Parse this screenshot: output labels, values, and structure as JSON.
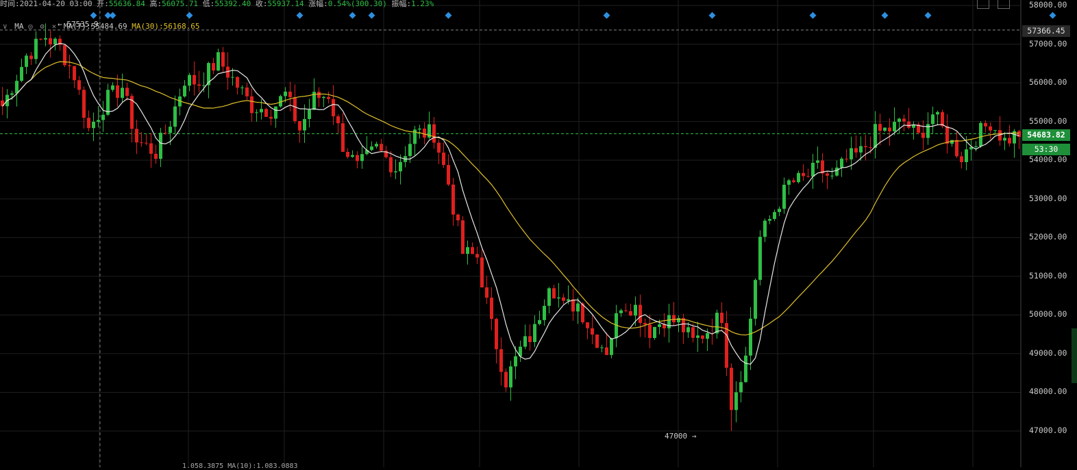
{
  "header": {
    "time_label": "时间:",
    "time": "2021-04-20 03:00",
    "open_label": "开:",
    "open": "55636.84",
    "high_label": "高:",
    "high": "56075.71",
    "low_label": "低:",
    "low": "55392.40",
    "close_label": "收:",
    "close": "55937.14",
    "change_label": "涨幅:",
    "change": "0.54%(300.30)",
    "amp_label": "振幅:",
    "amp": "1.23%"
  },
  "ma_bar": {
    "indicator": "MA",
    "ma7": "MA(7):55484.69",
    "ma30": "MA(30):56168.65"
  },
  "price_tags": {
    "high_line": "57366.45",
    "current": "54683.82",
    "timer": "53:30"
  },
  "annotations": {
    "max_marker": "← 57535.9",
    "min_marker": "47000 →"
  },
  "bottom_panel": {
    "text": "1.058.3875  MA(10):1.083.0883"
  },
  "colors": {
    "up": "#2fbf45",
    "down": "#e0201e",
    "ma7": "#e8e8e8",
    "ma30": "#e0c12c",
    "grid": "#1f1f1f",
    "signal_marker": "#2d8fe0"
  },
  "chart_data": {
    "type": "candlestick",
    "title": "",
    "y_axis_ticks": [
      58000,
      57000,
      56000,
      55000,
      54000,
      53000,
      52000,
      51000,
      50000,
      49000,
      48000,
      47000
    ],
    "y_axis_labels": [
      "58000.00",
      "57000.00",
      "56000.00",
      "55000.00",
      "54000.00",
      "53000.00",
      "52000.00",
      "51000.00",
      "50000.00",
      "49000.00",
      "48000.00",
      "47000.00"
    ],
    "ylim": [
      46800,
      58000
    ],
    "grid": true,
    "reference_lines": {
      "high": 57366.45,
      "current": 54683.82
    },
    "signal_marker_candle_index": [
      19,
      22,
      23,
      39,
      62,
      73,
      77,
      93,
      126,
      148,
      169,
      184,
      193,
      219
    ],
    "price_anchors": [
      [
        0,
        55400
      ],
      [
        5,
        56700
      ],
      [
        9,
        57200
      ],
      [
        12,
        56900
      ],
      [
        15,
        56200
      ],
      [
        18,
        54800
      ],
      [
        22,
        55600
      ],
      [
        25,
        55900
      ],
      [
        28,
        54500
      ],
      [
        32,
        54200
      ],
      [
        35,
        55000
      ],
      [
        38,
        56100
      ],
      [
        41,
        56000
      ],
      [
        45,
        56600
      ],
      [
        48,
        56100
      ],
      [
        52,
        55400
      ],
      [
        56,
        55300
      ],
      [
        59,
        55700
      ],
      [
        62,
        54800
      ],
      [
        65,
        55600
      ],
      [
        68,
        55700
      ],
      [
        71,
        54400
      ],
      [
        74,
        53800
      ],
      [
        78,
        54300
      ],
      [
        82,
        53800
      ],
      [
        86,
        54700
      ],
      [
        90,
        54700
      ],
      [
        93,
        53400
      ],
      [
        96,
        51600
      ],
      [
        99,
        51500
      ],
      [
        102,
        49700
      ],
      [
        105,
        48300
      ],
      [
        108,
        49100
      ],
      [
        111,
        49600
      ],
      [
        114,
        50900
      ],
      [
        117,
        50200
      ],
      [
        120,
        50300
      ],
      [
        123,
        49500
      ],
      [
        126,
        49100
      ],
      [
        129,
        50300
      ],
      [
        132,
        50200
      ],
      [
        135,
        49600
      ],
      [
        138,
        49900
      ],
      [
        141,
        49800
      ],
      [
        144,
        49300
      ],
      [
        147,
        49600
      ],
      [
        150,
        50000
      ],
      [
        152,
        47700
      ],
      [
        155,
        48900
      ],
      [
        158,
        52000
      ],
      [
        161,
        52700
      ],
      [
        164,
        53400
      ],
      [
        167,
        53500
      ],
      [
        170,
        53800
      ],
      [
        173,
        53500
      ],
      [
        176,
        54000
      ],
      [
        179,
        54200
      ],
      [
        182,
        54700
      ],
      [
        185,
        54800
      ],
      [
        188,
        55000
      ],
      [
        191,
        54600
      ],
      [
        194,
        55200
      ],
      [
        197,
        54600
      ],
      [
        200,
        54100
      ],
      [
        203,
        54600
      ],
      [
        206,
        55000
      ],
      [
        209,
        54500
      ],
      [
        212,
        54700
      ]
    ],
    "min_price": 47000,
    "max_price": 57535.9,
    "series": [
      {
        "name": "MA(7)",
        "value_last": 55484.69
      },
      {
        "name": "MA(30)",
        "value_last": 56168.65
      }
    ]
  }
}
